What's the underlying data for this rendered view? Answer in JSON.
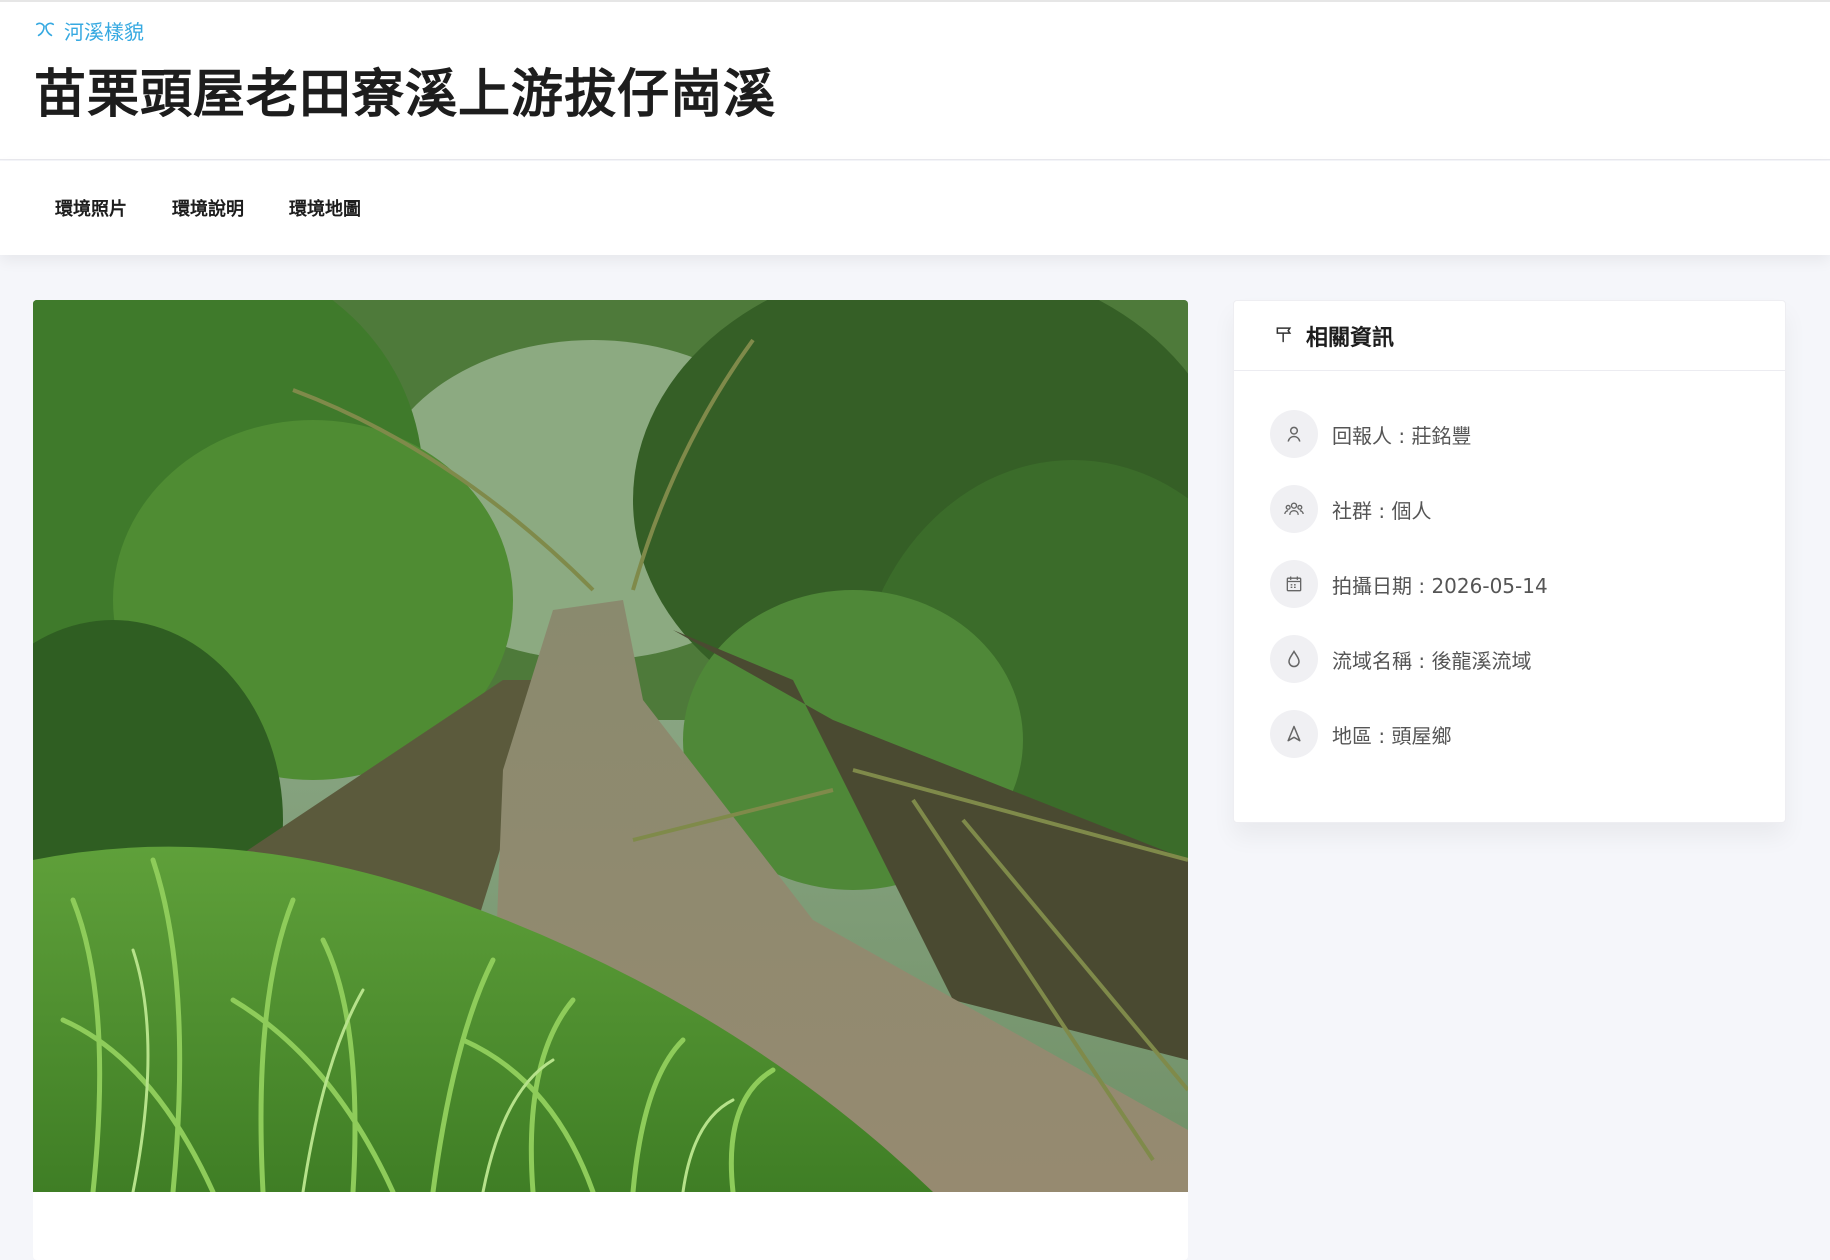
{
  "header": {
    "breadcrumb": "河溪樣貌",
    "title": "苗栗頭屋老田寮溪上游拔仔崗溪",
    "breadcrumb_icon": "leaf-icon",
    "accent_color": "#36a9e1"
  },
  "tabs": [
    {
      "label": "環境照片"
    },
    {
      "label": "環境說明"
    },
    {
      "label": "環境地圖"
    }
  ],
  "photo": {
    "description_icon": "stream-photo"
  },
  "sidebar": {
    "title": "相關資訊",
    "title_icon": "signpost-icon",
    "items": [
      {
        "icon": "user-icon",
        "label": "回報人",
        "sep": " : ",
        "value": "莊銘豐"
      },
      {
        "icon": "group-icon",
        "label": "社群",
        "sep": " : ",
        "value": "個人"
      },
      {
        "icon": "calendar-icon",
        "label": "拍攝日期",
        "sep": " : ",
        "value": "2026-05-14"
      },
      {
        "icon": "water-drop-icon",
        "label": "流域名稱",
        "sep": " : ",
        "value": "後龍溪流域"
      },
      {
        "icon": "location-icon",
        "label": "地區",
        "sep": " : ",
        "value": "頭屋鄉"
      }
    ]
  }
}
